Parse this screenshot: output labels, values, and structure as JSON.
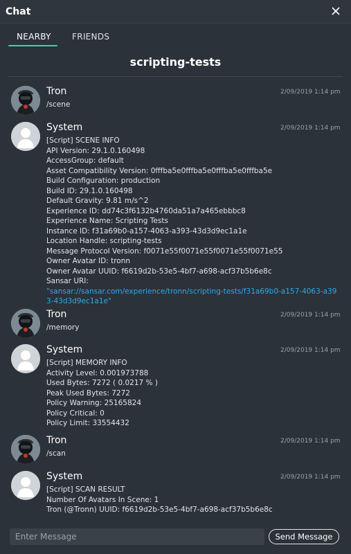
{
  "window": {
    "title": "Chat",
    "close_icon": "close-icon"
  },
  "tabs": [
    {
      "label": "NEARBY",
      "active": true
    },
    {
      "label": "FRIENDS",
      "active": false
    }
  ],
  "channel": "scripting-tests",
  "colors": {
    "accent": "#3ad6a8",
    "link": "#2fa9e8",
    "background": "#2b3239"
  },
  "messages": [
    {
      "sender": "Tron",
      "avatar": "tron-avatar",
      "time": "2/09/2019  1:14 pm",
      "lines": [
        "/scene"
      ]
    },
    {
      "sender": "System",
      "avatar": "default-user-avatar",
      "time": "2/09/2019  1:14 pm",
      "lines": [
        "[Script] SCENE INFO",
        "API Version: 29.1.0.160498",
        "AccessGroup: default",
        "Asset Compatibility Version: 0fffba5e0fffba5e0fffba5e0fffba5e",
        "Build Configuration: production",
        "Build ID: 29.1.0.160498",
        "Default Gravity: 9.81 m/s^2",
        "Experience ID: dd74c3f6132b4760da51a7a465ebbbc8",
        "Experience Name: Scripting Tests",
        "Instance ID: f31a69b0-a157-4063-a393-43d3d9ec1a1e",
        "Location Handle: scripting-tests",
        "Message Protocol Version: f0071e55f0071e55f0071e55f0071e55",
        "Owner Avatar ID: tronn",
        "Owner Avatar UUID: f6619d2b-53e5-4bf7-a698-acf37b5b6e8c",
        "Sansar URI:"
      ],
      "link": "\"sansar://sansar.com/experience/tronn/scripting-tests/f31a69b0-a157-4063-a393-43d3d9ec1a1e\""
    },
    {
      "sender": "Tron",
      "avatar": "tron-avatar",
      "time": "2/09/2019  1:14 pm",
      "lines": [
        "/memory"
      ]
    },
    {
      "sender": "System",
      "avatar": "default-user-avatar",
      "time": "2/09/2019  1:14 pm",
      "lines": [
        "[Script] MEMORY INFO",
        "Activity Level: 0.001973788",
        "Used Bytes: 7272 ( 0.0217 % )",
        "Peak Used Bytes: 7272",
        "Policy Warning: 25165824",
        "Policy Critical: 0",
        "Policy Limit: 33554432"
      ]
    },
    {
      "sender": "Tron",
      "avatar": "tron-avatar",
      "time": "2/09/2019  1:14 pm",
      "lines": [
        "/scan"
      ]
    },
    {
      "sender": "System",
      "avatar": "default-user-avatar",
      "time": "2/09/2019  1:14 pm",
      "lines": [
        "[Script] SCAN RESULT",
        "Number Of Avatars In Scene: 1",
        "Tron (@Tronn) UUID: f6619d2b-53e5-4bf7-a698-acf37b5b6e8c"
      ]
    }
  ],
  "composer": {
    "placeholder": "Enter Message",
    "value": "",
    "send_label": "Send Message"
  }
}
